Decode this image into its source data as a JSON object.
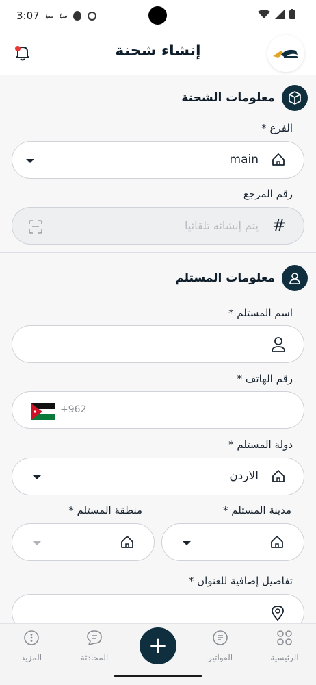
{
  "status_bar": {
    "time": "3:07"
  },
  "header": {
    "title": "إنشاء شحنة"
  },
  "shipment_section": {
    "title": "معلومات الشحنة",
    "branch": {
      "label": "الفرع *",
      "value": "main"
    },
    "reference": {
      "label": "رقم المرجع",
      "placeholder": "يتم إنشائه تلقائيا",
      "hash": "#"
    }
  },
  "recipient_section": {
    "title": "معلومات المستلم",
    "name": {
      "label": "اسم المستلم *",
      "value": ""
    },
    "phone": {
      "label": "رقم الهاتف *",
      "code": "+962"
    },
    "country": {
      "label": "دولة المستلم *",
      "value": "الاردن"
    },
    "city": {
      "label": "مدينة المستلم *"
    },
    "region": {
      "label": "منطقة المستلم *"
    },
    "address": {
      "label": "تفاصيل إضافية للعنوان *"
    }
  },
  "bottom_nav": {
    "home": "الرئيسية",
    "invoices": "الفواتير",
    "add": "+",
    "chat": "المحادثة",
    "more": "المزيد"
  },
  "colors": {
    "primary": "#0f2f3e",
    "accent": "#e53935",
    "field_border": "#cfd3d8"
  }
}
